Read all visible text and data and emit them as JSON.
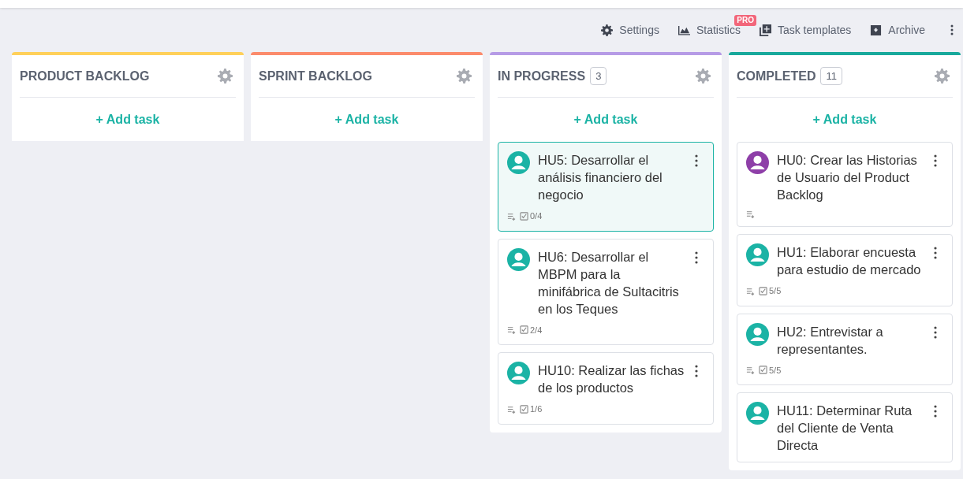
{
  "toolbar": [
    {
      "label": "Settings"
    },
    {
      "label": "Statistics",
      "badge": "PRO"
    },
    {
      "label": "Task templates"
    },
    {
      "label": "Archive"
    }
  ],
  "columns": [
    {
      "title": "PRODUCT BACKLOG",
      "color": "#ffd05a",
      "add_label": "+ Add task"
    },
    {
      "title": "SPRINT BACKLOG",
      "color": "#fb8b6c",
      "add_label": "+ Add task"
    },
    {
      "title": "IN PROGRESS",
      "count": "3",
      "color": "#b69be6",
      "add_label": "+ Add task",
      "cards": [
        {
          "title": "HU5: Desarrollar el análisis financiero del negocio",
          "checklist": "0/4",
          "selected": true,
          "color": "#1bb3a5"
        },
        {
          "title": "HU6: Desarrollar el MBPM para la minifábrica de Sultacitris en los Teques",
          "checklist": "2/4",
          "selected": false,
          "color": "#1bb3a5"
        },
        {
          "title": "HU10: Realizar las fichas de los productos",
          "checklist": "1/6",
          "selected": false,
          "color": "#1bb3a5"
        }
      ]
    },
    {
      "title": "COMPLETED",
      "count": "11",
      "color": "#19a99c",
      "add_label": "+ Add task",
      "cards": [
        {
          "title": "HU0: Crear las Historias de Usuario del Product Backlog",
          "selected": false,
          "color": "#8e3fa8"
        },
        {
          "title": "HU1: Elaborar encuesta para estudio de mercado",
          "checklist": "5/5",
          "selected": false,
          "color": "#1bb3a5"
        },
        {
          "title": "HU2: Entrevistar a representantes.",
          "checklist": "5/5",
          "selected": false,
          "color": "#1bb3a5"
        },
        {
          "title": "HU11: Determinar Ruta del Cliente de Venta Directa",
          "selected": false,
          "color": "#1bb3a5"
        }
      ]
    }
  ]
}
